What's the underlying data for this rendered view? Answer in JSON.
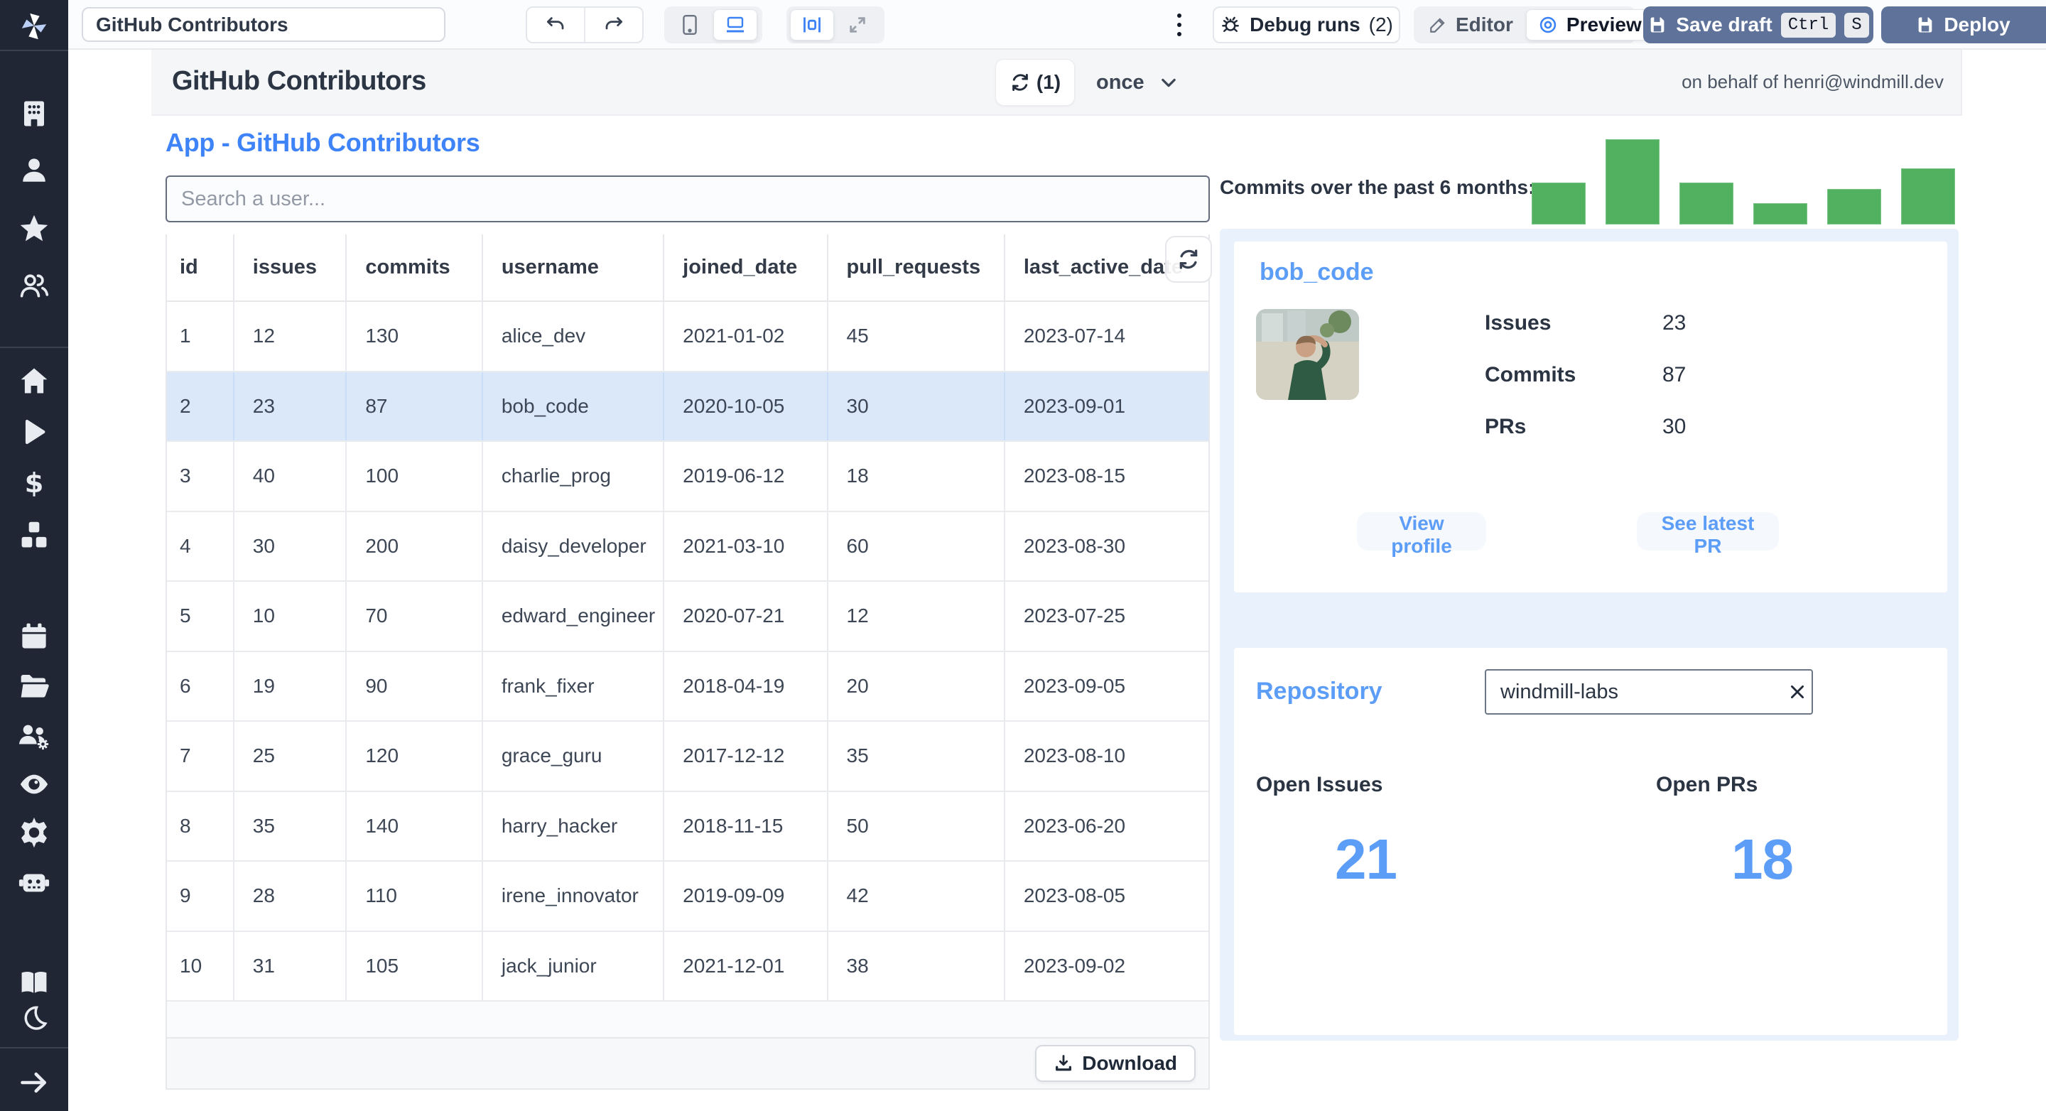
{
  "toolbar": {
    "app_title_input": "GitHub Contributors",
    "debug_runs_label": "Debug runs",
    "debug_runs_count": "(2)",
    "editor_label": "Editor",
    "preview_label": "Preview",
    "save_draft_label": "Save draft",
    "kbd": [
      "Ctrl",
      "S"
    ],
    "deploy_label": "Deploy"
  },
  "header": {
    "title": "GitHub Contributors",
    "refresh_count": "(1)",
    "schedule_mode": "once",
    "on_behalf": "on behalf of henri@windmill.dev"
  },
  "app": {
    "title": "App - GitHub Contributors",
    "search_placeholder": "Search a user..."
  },
  "table": {
    "columns": [
      "id",
      "issues",
      "commits",
      "username",
      "joined_date",
      "pull_requests",
      "last_active_date"
    ],
    "rows": [
      [
        "1",
        "12",
        "130",
        "alice_dev",
        "2021-01-02",
        "45",
        "2023-07-14"
      ],
      [
        "2",
        "23",
        "87",
        "bob_code",
        "2020-10-05",
        "30",
        "2023-09-01"
      ],
      [
        "3",
        "40",
        "100",
        "charlie_prog",
        "2019-06-12",
        "18",
        "2023-08-15"
      ],
      [
        "4",
        "30",
        "200",
        "daisy_developer",
        "2021-03-10",
        "60",
        "2023-08-30"
      ],
      [
        "5",
        "10",
        "70",
        "edward_engineer",
        "2020-07-21",
        "12",
        "2023-07-25"
      ],
      [
        "6",
        "19",
        "90",
        "frank_fixer",
        "2018-04-19",
        "20",
        "2023-09-05"
      ],
      [
        "7",
        "25",
        "120",
        "grace_guru",
        "2017-12-12",
        "35",
        "2023-08-10"
      ],
      [
        "8",
        "35",
        "140",
        "harry_hacker",
        "2018-11-15",
        "50",
        "2023-06-20"
      ],
      [
        "9",
        "28",
        "110",
        "irene_innovator",
        "2019-09-09",
        "42",
        "2023-08-05"
      ],
      [
        "10",
        "31",
        "105",
        "jack_junior",
        "2021-12-01",
        "38",
        "2023-09-02"
      ]
    ],
    "selected_row_index": 1,
    "download_label": "Download"
  },
  "chart_data": {
    "type": "bar",
    "title": "Commits over the past 6 months:",
    "values": [
      49,
      100,
      49,
      25,
      42,
      66
    ],
    "value_unit": "relative-height-percent-of-max",
    "bar_count": 6,
    "bar_color": "#52B061",
    "axes_visible": false,
    "legend": "none"
  },
  "profile_card": {
    "username": "bob_code",
    "stats": [
      {
        "label": "Issues",
        "value": "23"
      },
      {
        "label": "Commits",
        "value": "87"
      },
      {
        "label": "PRs",
        "value": "30"
      }
    ],
    "view_profile_label": "View profile",
    "see_latest_pr_label": "See latest PR"
  },
  "repo_card": {
    "title": "Repository",
    "input_value": "windmill-labs",
    "open_issues_label": "Open Issues",
    "open_issues_value": "21",
    "open_prs_label": "Open PRs",
    "open_prs_value": "18"
  },
  "sidebar": {
    "icons": [
      "windmill-logo",
      "building",
      "user",
      "star",
      "user-group",
      "home",
      "play",
      "dollar",
      "cubes",
      "calendar",
      "folder-open",
      "group-settings",
      "eye",
      "gear",
      "robot",
      "book",
      "moon",
      "arrow-right"
    ]
  },
  "colors": {
    "sidebar_bg": "#202634",
    "accent_blue": "#3F83F8",
    "link_blue": "#5C9DF7",
    "slate_button": "#5F739A",
    "bar_green": "#52B061",
    "selected_row": "#DBE8FA",
    "panel_blue": "#E9F1FD"
  }
}
